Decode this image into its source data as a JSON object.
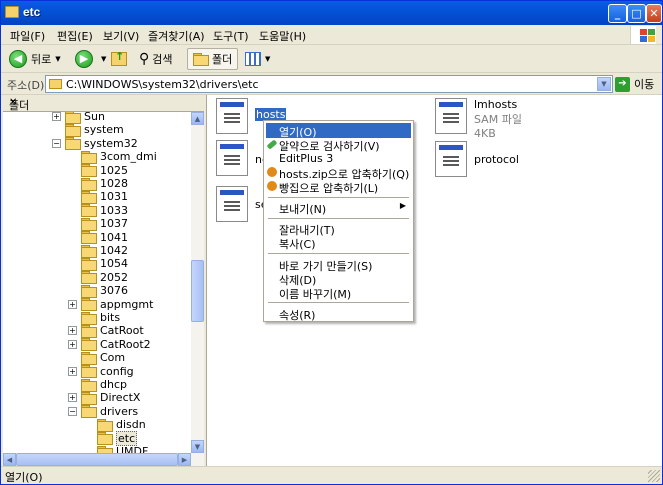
{
  "window": {
    "title": "etc"
  },
  "menu": [
    "파일(F)",
    "편집(E)",
    "보기(V)",
    "즐겨찾기(A)",
    "도구(T)",
    "도움말(H)"
  ],
  "toolbar": {
    "back": "뒤로",
    "search": "검색",
    "folders": "폴더"
  },
  "address": {
    "label": "주소(D)",
    "path": "C:\\WINDOWS\\system32\\drivers\\etc",
    "go": "이동"
  },
  "folders_pane": {
    "title": "폴더"
  },
  "tree": [
    {
      "label": "Sun",
      "expander": "+"
    },
    {
      "label": "system",
      "expander": ""
    },
    {
      "label": "system32",
      "expander": "−"
    },
    {
      "label": "3com_dmi",
      "expander": ""
    },
    {
      "label": "1025",
      "expander": ""
    },
    {
      "label": "1028",
      "expander": ""
    },
    {
      "label": "1031",
      "expander": ""
    },
    {
      "label": "1033",
      "expander": ""
    },
    {
      "label": "1037",
      "expander": ""
    },
    {
      "label": "1041",
      "expander": ""
    },
    {
      "label": "1042",
      "expander": ""
    },
    {
      "label": "1054",
      "expander": ""
    },
    {
      "label": "2052",
      "expander": ""
    },
    {
      "label": "3076",
      "expander": ""
    },
    {
      "label": "appmgmt",
      "expander": "+"
    },
    {
      "label": "bits",
      "expander": ""
    },
    {
      "label": "CatRoot",
      "expander": "+"
    },
    {
      "label": "CatRoot2",
      "expander": "+"
    },
    {
      "label": "Com",
      "expander": ""
    },
    {
      "label": "config",
      "expander": "+"
    },
    {
      "label": "dhcp",
      "expander": ""
    },
    {
      "label": "DirectX",
      "expander": "+"
    },
    {
      "label": "drivers",
      "expander": "−"
    },
    {
      "label": "disdn",
      "expander": ""
    },
    {
      "label": "etc",
      "expander": ""
    },
    {
      "label": "UMDF",
      "expander": ""
    }
  ],
  "files": [
    {
      "name": "hosts",
      "sub1": "",
      "sub2": ""
    },
    {
      "name": "ne",
      "sub1": "",
      "sub2": ""
    },
    {
      "name": "se",
      "sub1": "",
      "sub2": ""
    },
    {
      "name": "lmhosts",
      "sub1": "SAM 파일",
      "sub2": "4KB"
    },
    {
      "name": "protocol",
      "sub1": "",
      "sub2": ""
    }
  ],
  "context_menu": [
    {
      "label": "열기(O)",
      "icon": ""
    },
    {
      "label": "알약으로 검사하기(V)",
      "icon": "#44aa44"
    },
    {
      "label": "EditPlus 3",
      "icon": ""
    },
    {
      "label": "hosts.zip으로 압축하기(Q)",
      "icon": "#e08a1a"
    },
    {
      "label": "빵집으로 압축하기(L)",
      "icon": "#e08a1a"
    },
    {
      "label": "보내기(N)",
      "icon": "",
      "submenu": "▶"
    },
    {
      "label": "잘라내기(T)",
      "icon": ""
    },
    {
      "label": "복사(C)",
      "icon": ""
    },
    {
      "label": "바로 가기 만들기(S)",
      "icon": ""
    },
    {
      "label": "삭제(D)",
      "icon": ""
    },
    {
      "label": "이름 바꾸기(M)",
      "icon": ""
    },
    {
      "label": "속성(R)",
      "icon": ""
    }
  ],
  "status": {
    "text": "열기(O)"
  }
}
